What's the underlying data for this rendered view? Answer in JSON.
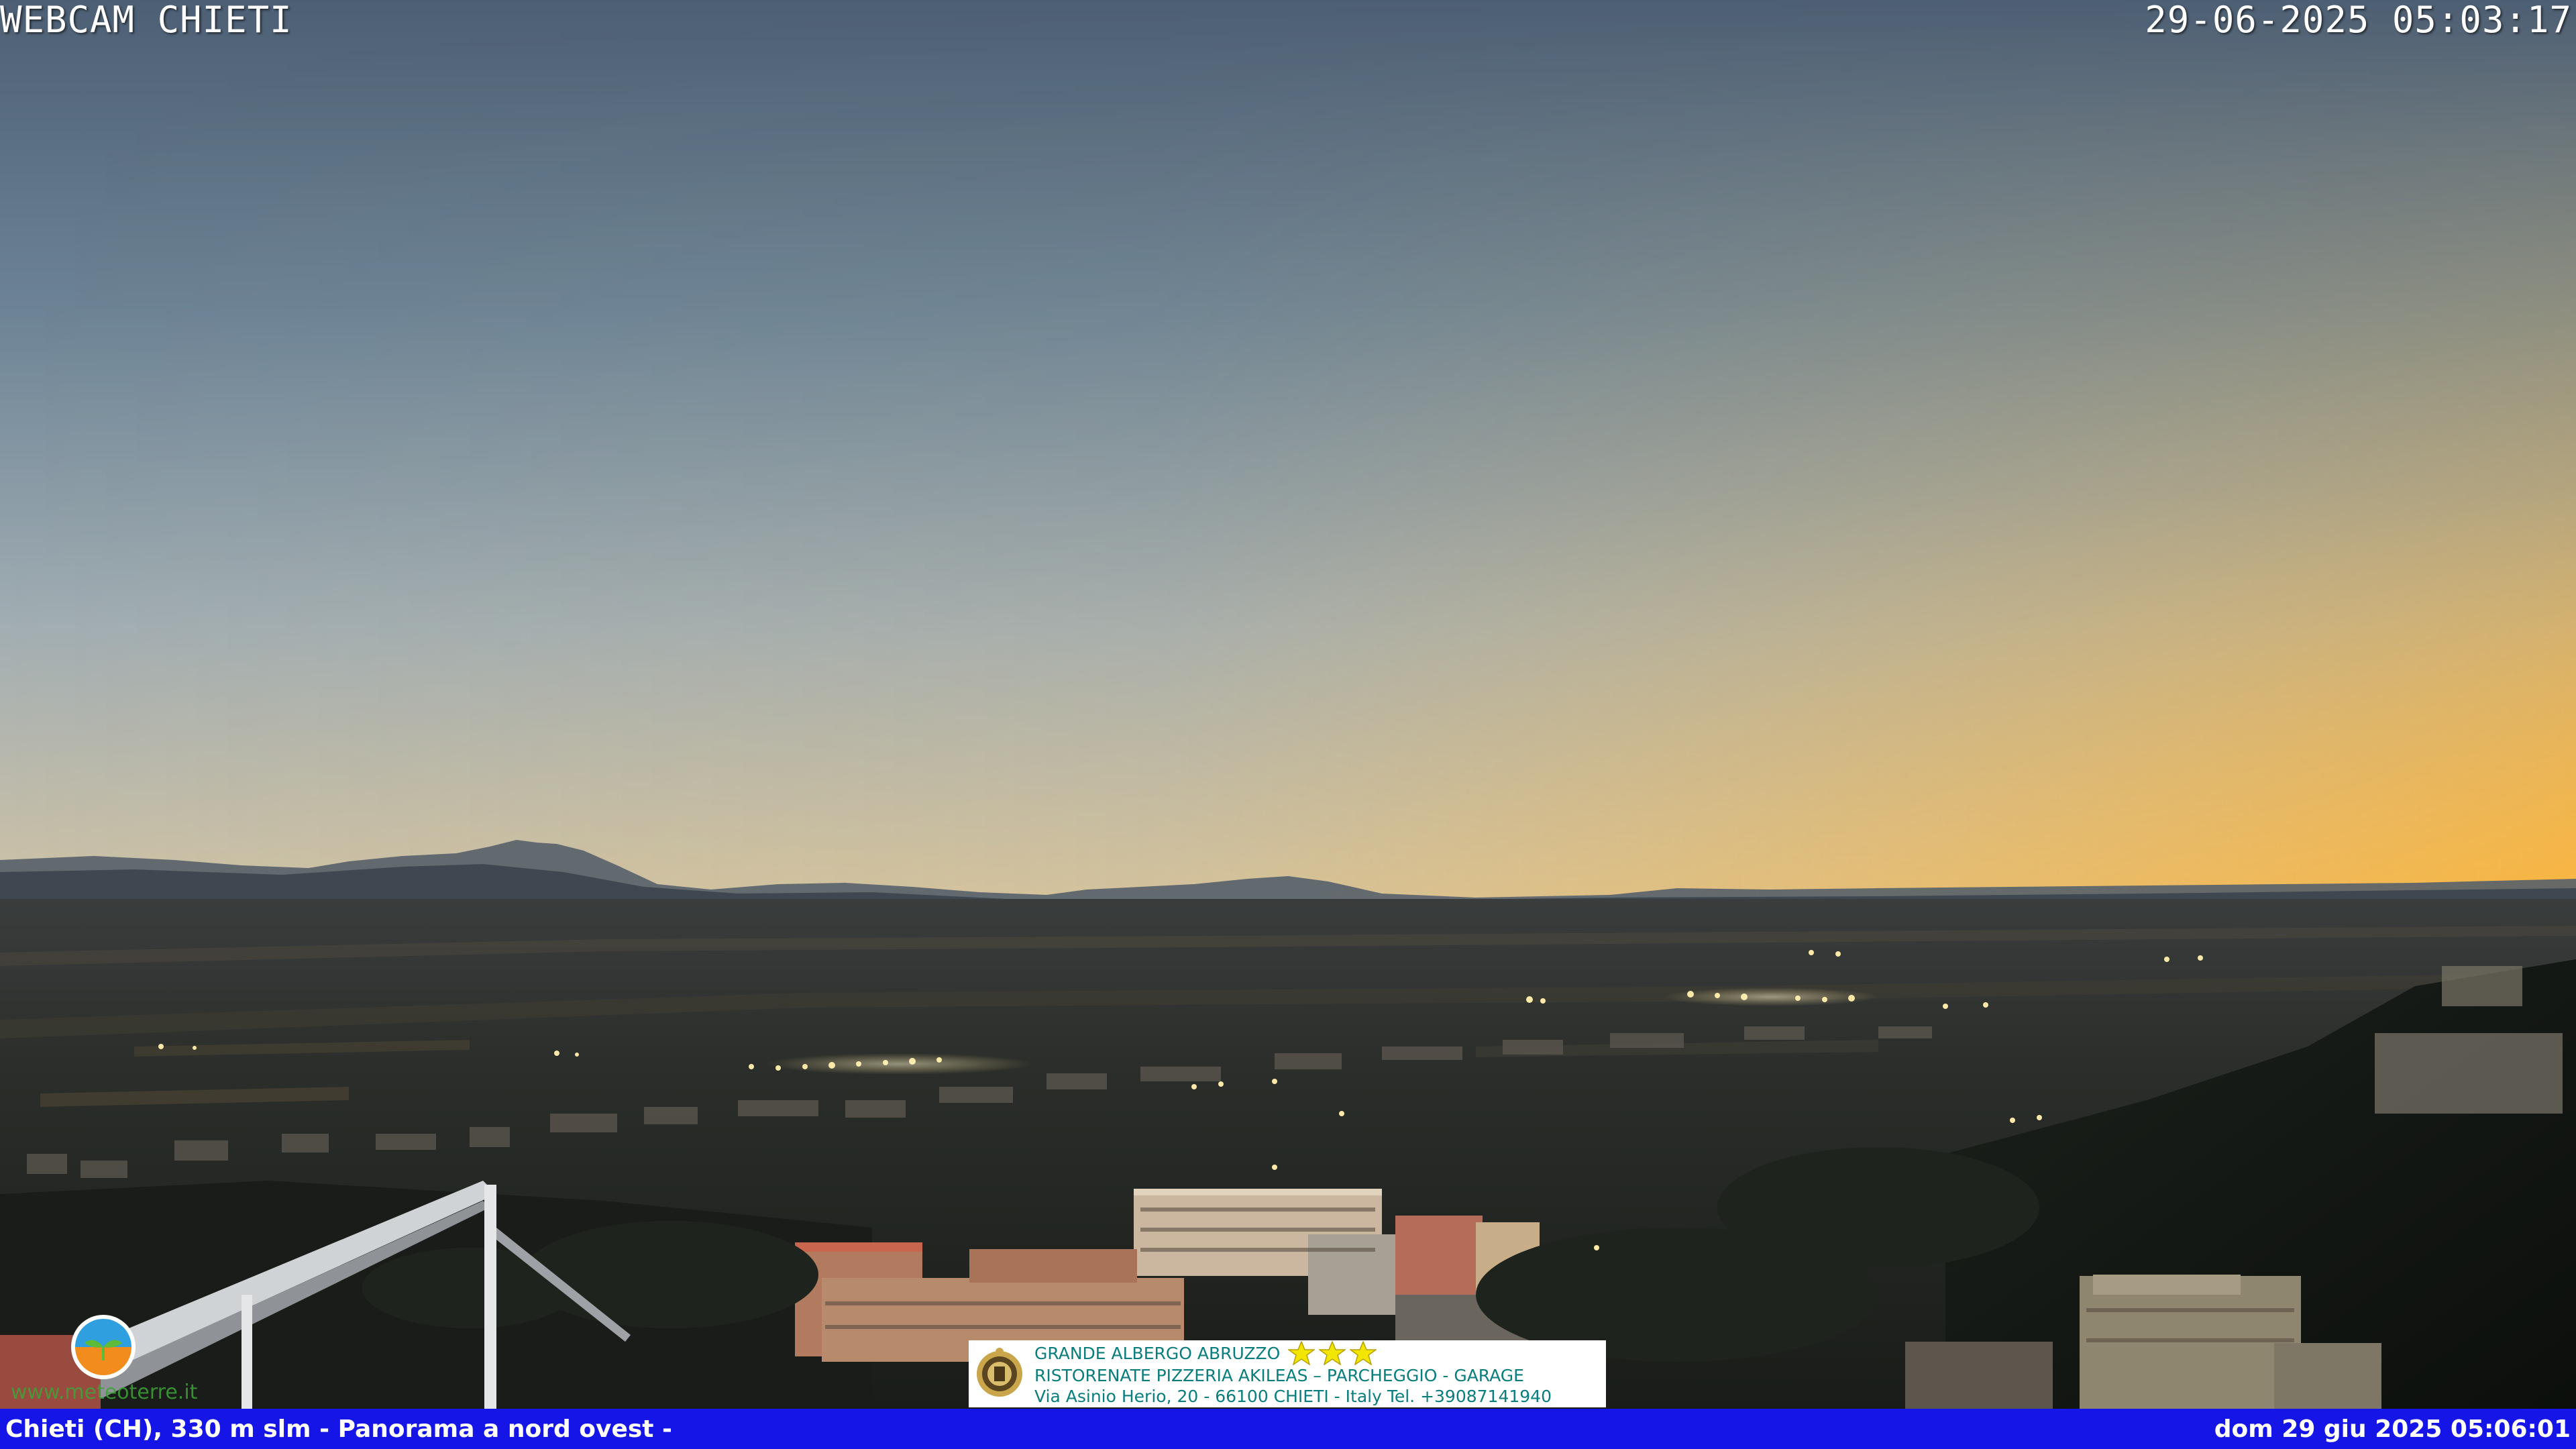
{
  "overlay": {
    "title": "WEBCAM CHIETI",
    "capture_time": "29-06-2025 05:03:17"
  },
  "bottom_bar": {
    "location": "Chieti (CH), 330 m slm - Panorama a nord ovest -",
    "datetime": "dom 29 giu 2025 05:06:01",
    "background": "#1515e8"
  },
  "ad": {
    "line1": "GRANDE ALBERGO ABRUZZO",
    "line2": "RISTORENATE PIZZERIA AKILEAS – PARCHEGGIO - GARAGE",
    "line3": "Via Asinio Herio, 20 - 66100 CHIETI - Italy Tel. +39087141940",
    "star_count": 3,
    "text_color": "#0a7d7d",
    "star_color": "#f2e600"
  },
  "watermark": {
    "text": "www.meteoterre.it",
    "text_color": "#3fa23a"
  },
  "colors": {
    "sky_top": "#4d5f74",
    "sky_mid": "#a9b6b8",
    "sky_horizon_right": "#f7bd4d",
    "city_lights": "#ffe9a8"
  }
}
